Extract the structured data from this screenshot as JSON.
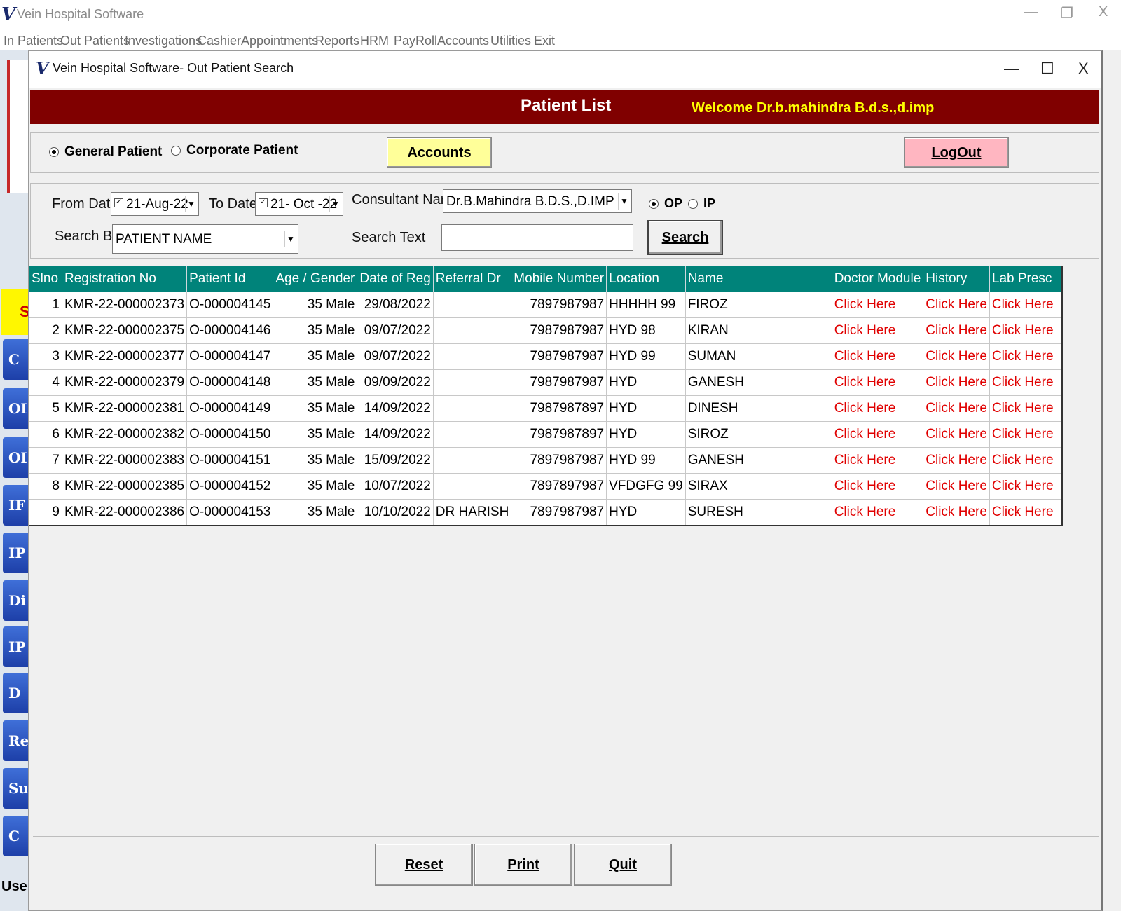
{
  "app": {
    "title": "Vein Hospital Software",
    "logo_text": "V",
    "controls": {
      "minimize": "—",
      "restore": "❐",
      "close": "X"
    }
  },
  "menu": [
    "In Patients",
    "Out Patients",
    "Investigations",
    "Cashier",
    "Appointments",
    "Reports",
    "HRM",
    "PayRoll",
    "Accounts",
    "Utilities",
    "Exit"
  ],
  "background": {
    "yellow_letter": "S",
    "side_buttons": [
      "C",
      "OI",
      "OI",
      "IF",
      "IP I",
      "Di",
      "IP",
      "D",
      "Res",
      "Su",
      "C"
    ],
    "user_label": "User"
  },
  "dialog": {
    "title": "Vein Hospital Software- Out Patient Search",
    "controls": {
      "minimize": "—",
      "maximize": "☐",
      "close": "X"
    },
    "banner": {
      "title": "Patient List",
      "welcome": "Welcome Dr.b.mahindra B.d.s.,d.imp"
    },
    "patient_type": {
      "general": "General Patient",
      "corporate": "Corporate Patient",
      "selected": "general"
    },
    "accounts_label": "Accounts",
    "logout_label": "LogOut",
    "filters": {
      "from_date_label": "From Date",
      "from_date": "21-Aug-22",
      "to_date_label": "To Date",
      "to_date": "21- Oct -22",
      "consultant_label": "Consultant Name",
      "consultant": "Dr.B.Mahindra B.D.S.,D.IMP",
      "op_label": "OP",
      "ip_label": "IP",
      "op_selected": true,
      "search_by_label": "Search By",
      "search_by": "PATIENT NAME",
      "search_text_label": "Search Text",
      "search_text": "",
      "search_label": "Search"
    },
    "table": {
      "headers": [
        "Slno",
        "Registration No",
        "Patient Id",
        "Age / Gender",
        "Date of Reg",
        "Referral Dr",
        "Mobile Number",
        "Location",
        "Name",
        "Doctor Module",
        "History",
        "Lab Presc"
      ],
      "rows": [
        [
          "1",
          "KMR-22-000002373",
          "O-000004145",
          "35 Male",
          "29/08/2022",
          "",
          "7897987987",
          "HHHHH 99",
          "FIROZ",
          "Click Here",
          "Click Here",
          "Click Here"
        ],
        [
          "2",
          "KMR-22-000002375",
          "O-000004146",
          "35 Male",
          "09/07/2022",
          "",
          "7987987987",
          "HYD 98",
          "KIRAN",
          "Click Here",
          "Click Here",
          "Click Here"
        ],
        [
          "3",
          "KMR-22-000002377",
          "O-000004147",
          "35 Male",
          "09/07/2022",
          "",
          "7987987987",
          "HYD 99",
          "SUMAN",
          "Click Here",
          "Click Here",
          "Click Here"
        ],
        [
          "4",
          "KMR-22-000002379",
          "O-000004148",
          "35 Male",
          "09/09/2022",
          "",
          "7987987987",
          "HYD",
          "GANESH",
          "Click Here",
          "Click Here",
          "Click Here"
        ],
        [
          "5",
          "KMR-22-000002381",
          "O-000004149",
          "35 Male",
          "14/09/2022",
          "",
          "7987987897",
          "HYD",
          "DINESH",
          "Click Here",
          "Click Here",
          "Click Here"
        ],
        [
          "6",
          "KMR-22-000002382",
          "O-000004150",
          "35 Male",
          "14/09/2022",
          "",
          "7987987897",
          "HYD",
          "SIROZ",
          "Click Here",
          "Click Here",
          "Click Here"
        ],
        [
          "7",
          "KMR-22-000002383",
          "O-000004151",
          "35 Male",
          "15/09/2022",
          "",
          "7897987987",
          "HYD 99",
          "GANESH",
          "Click Here",
          "Click Here",
          "Click Here"
        ],
        [
          "8",
          "KMR-22-000002385",
          "O-000004152",
          "35 Male",
          "10/07/2022",
          "",
          "7897897987",
          "VFDGFG 99",
          "SIRAX",
          "Click Here",
          "Click Here",
          "Click Here"
        ],
        [
          "9",
          "KMR-22-000002386",
          "O-000004153",
          "35 Male",
          "10/10/2022",
          "DR HARISH",
          "7897987987",
          "HYD",
          "SURESH",
          "Click Here",
          "Click Here",
          "Click Here"
        ]
      ]
    },
    "footer": {
      "reset": "Reset",
      "print": "Print",
      "quit": "Quit"
    }
  }
}
